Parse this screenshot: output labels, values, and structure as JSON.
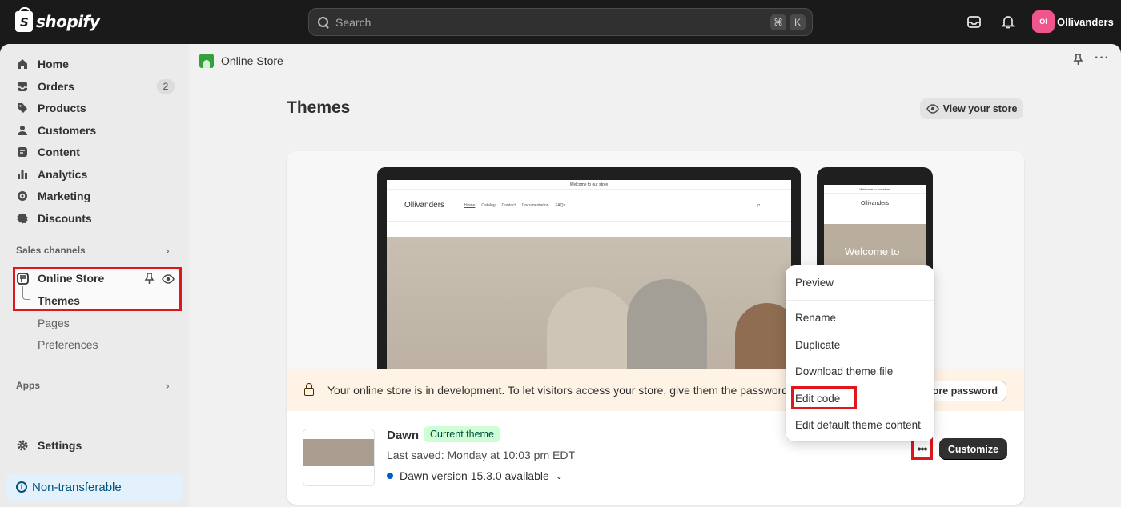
{
  "topbar": {
    "logo_text": "shopify",
    "search_placeholder": "Search",
    "shortcut_keys": [
      "⌘",
      "K"
    ],
    "avatar_initials": "Ol",
    "store_name": "Ollivanders"
  },
  "sidebar": {
    "items": [
      {
        "label": "Home",
        "icon": "home-icon"
      },
      {
        "label": "Orders",
        "icon": "orders-icon",
        "badge": "2"
      },
      {
        "label": "Products",
        "icon": "tag-icon"
      },
      {
        "label": "Customers",
        "icon": "person-icon"
      },
      {
        "label": "Content",
        "icon": "content-icon"
      },
      {
        "label": "Analytics",
        "icon": "chart-icon"
      },
      {
        "label": "Marketing",
        "icon": "target-icon"
      },
      {
        "label": "Discounts",
        "icon": "discount-icon"
      }
    ],
    "sales_channels_label": "Sales channels",
    "online_store_label": "Online Store",
    "sub_items": [
      "Themes",
      "Pages",
      "Preferences"
    ],
    "apps_label": "Apps",
    "settings_label": "Settings",
    "notice_label": "Non-transferable"
  },
  "main": {
    "breadcrumb": "Online Store",
    "page_title": "Themes",
    "view_store_label": "View your store"
  },
  "preview": {
    "announcement": "Welcome to our store",
    "brand": "Ollivanders",
    "nav_links": [
      "Home",
      "Catalog",
      "Contact",
      "Documentation",
      "FAQs"
    ],
    "phone_hero_text": "Welcome to"
  },
  "banner": {
    "text": "Your online store is in development. To let visitors access your store, give them the password.",
    "button_label": "tore password"
  },
  "theme": {
    "name": "Dawn",
    "badge": "Current theme",
    "last_saved": "Last saved: Monday at 10:03 pm EDT",
    "version": "Dawn version 15.3.0 available",
    "more_label": "•••",
    "customize_label": "Customize"
  },
  "menu": {
    "items": [
      "Preview",
      "Rename",
      "Duplicate",
      "Download theme file",
      "Edit code",
      "Edit default theme content"
    ]
  },
  "colors": {
    "accent_red": "#e0161c",
    "current_badge_bg": "#cdfed4",
    "banner_bg": "#fff3e6"
  }
}
